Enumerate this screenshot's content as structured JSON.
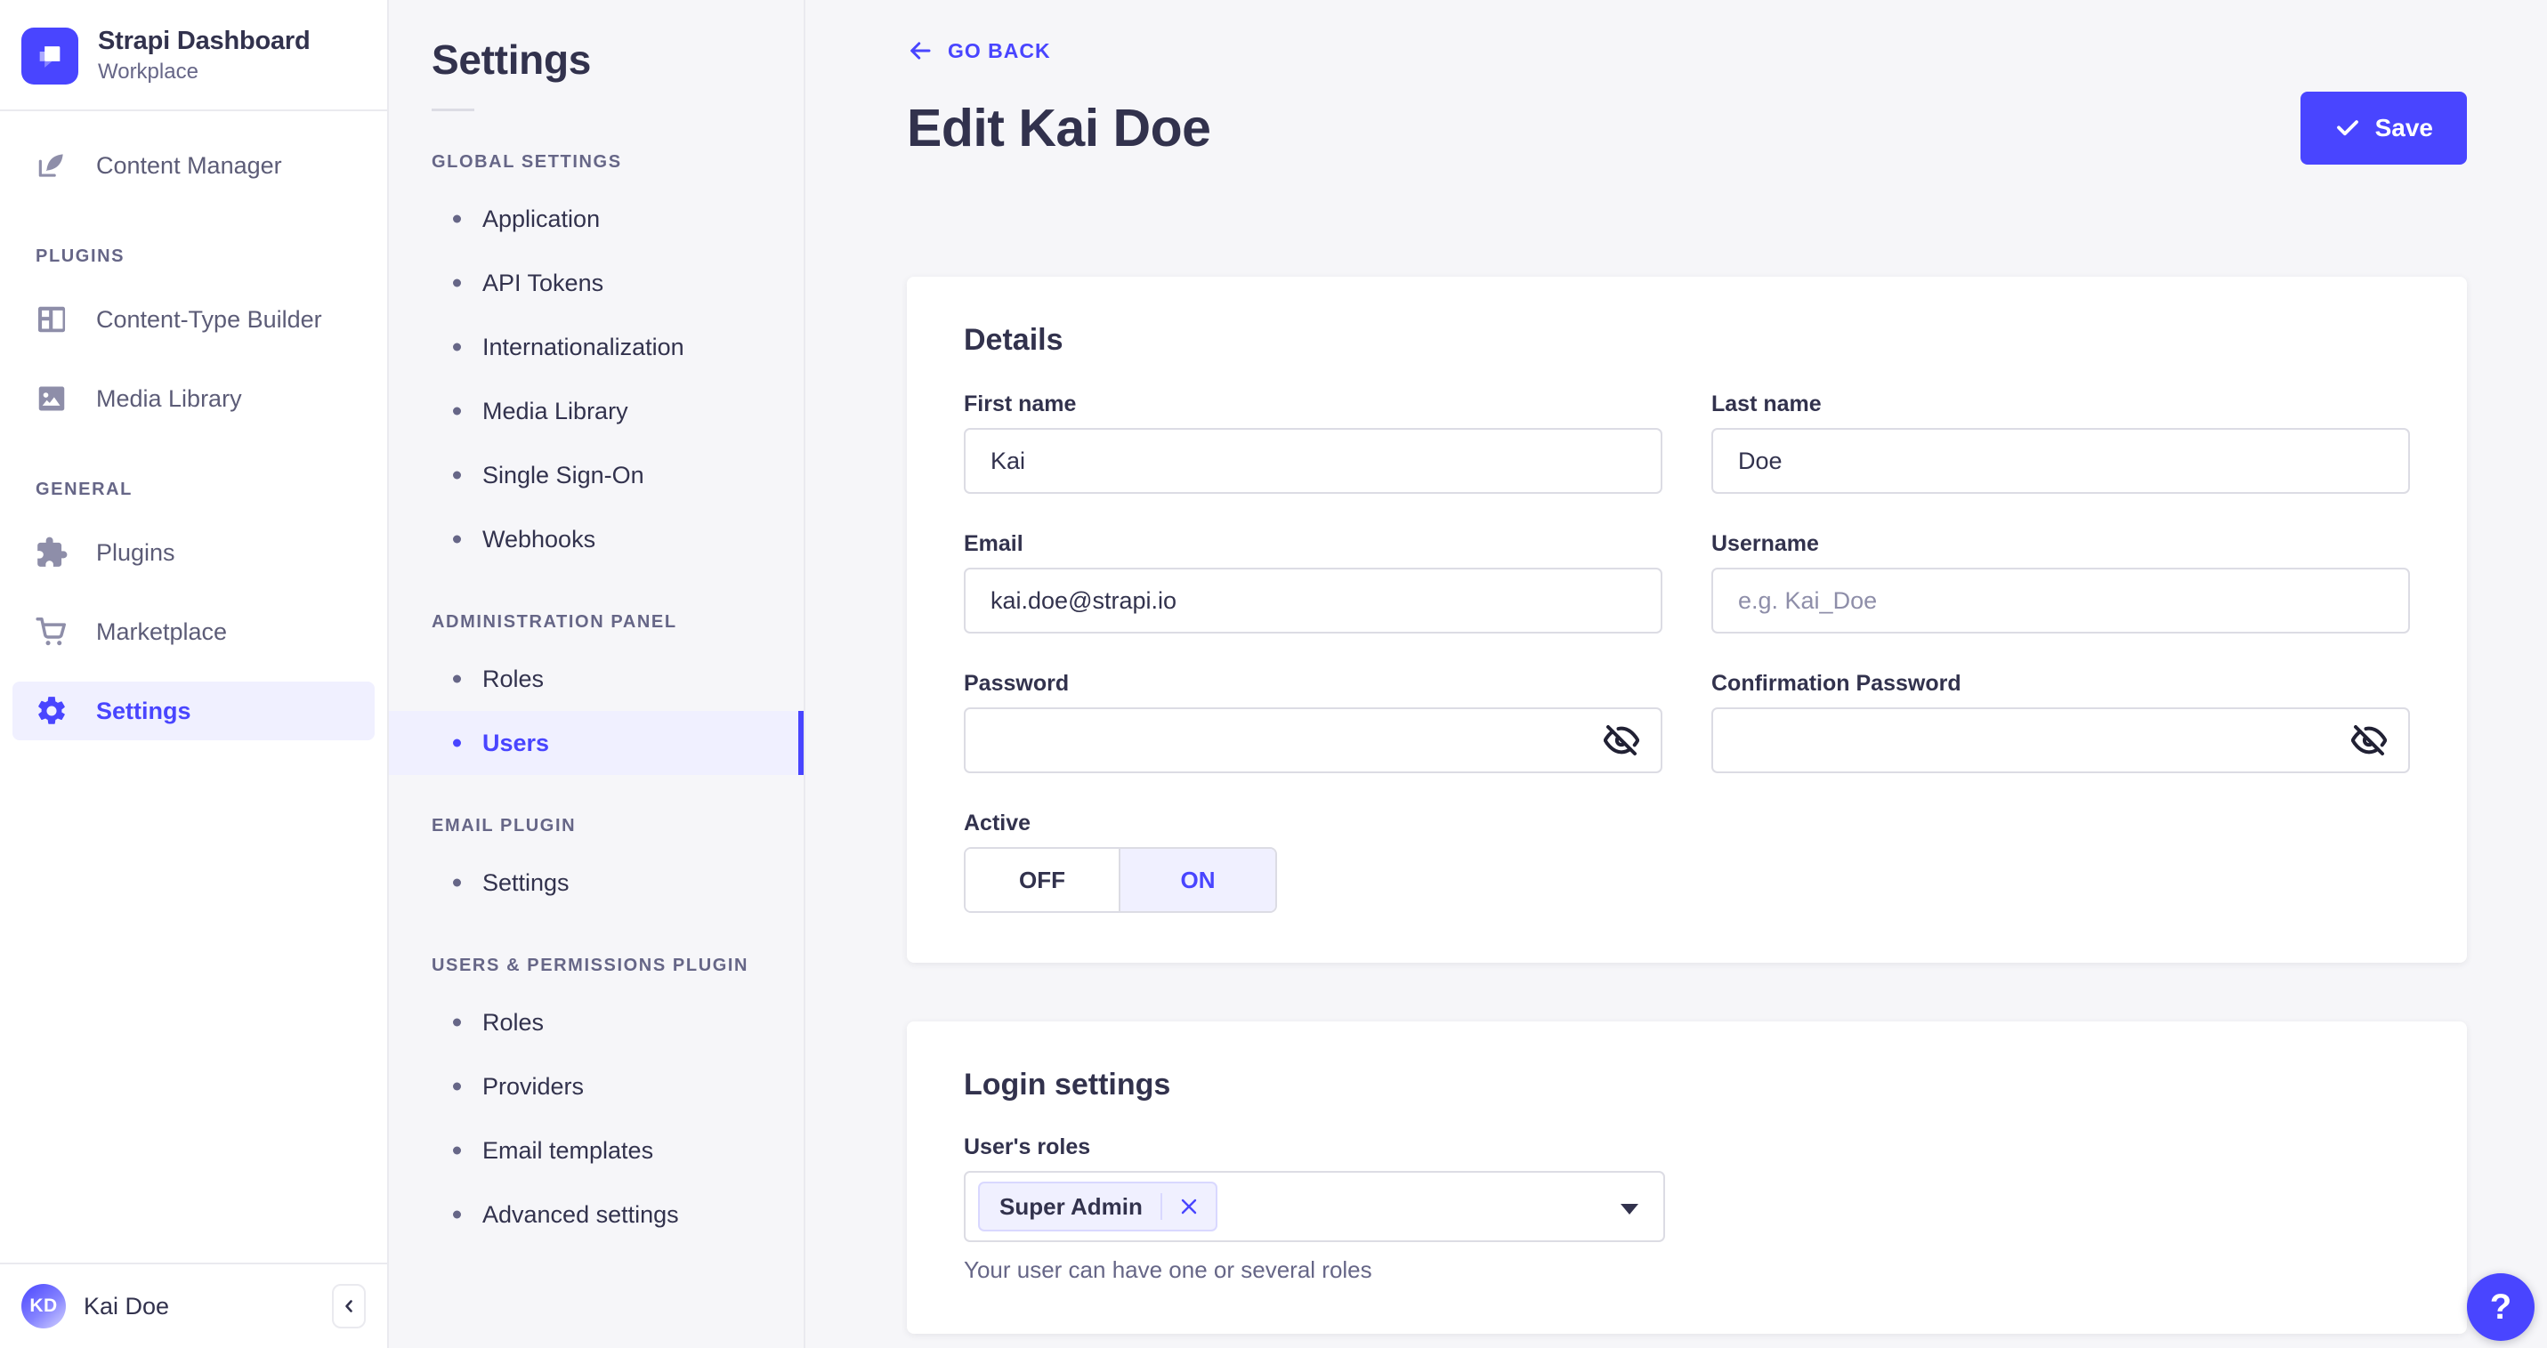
{
  "colors": {
    "primary": "#4945ff",
    "primary_light_bg": "#f0f0ff",
    "text_dark": "#32324d",
    "text_muted": "#666687",
    "input_border": "#dcdce4",
    "divider": "#eaeaef",
    "page_bg": "#f6f6f9",
    "placeholder": "#8e8ea9"
  },
  "brand": {
    "title": "Strapi Dashboard",
    "subtitle": "Workplace"
  },
  "sidebar": {
    "content_manager": {
      "label": "Content Manager",
      "icon": "feather-pen-icon"
    },
    "sections": [
      {
        "header": "Plugins",
        "items": [
          {
            "label": "Content-Type Builder",
            "icon": "layout-icon"
          },
          {
            "label": "Media Library",
            "icon": "image-icon"
          }
        ]
      },
      {
        "header": "General",
        "items": [
          {
            "label": "Plugins",
            "icon": "puzzle-icon"
          },
          {
            "label": "Marketplace",
            "icon": "cart-icon"
          },
          {
            "label": "Settings",
            "icon": "gear-icon",
            "active": true
          }
        ]
      }
    ],
    "user": {
      "initials": "KD",
      "name": "Kai Doe"
    },
    "collapse_glyph": "‹"
  },
  "subnav": {
    "title": "Settings",
    "sections": [
      {
        "header": "Global Settings",
        "items": [
          "Application",
          "API Tokens",
          "Internationalization",
          "Media Library",
          "Single Sign-On",
          "Webhooks"
        ]
      },
      {
        "header": "Administration Panel",
        "items": [
          "Roles",
          "Users"
        ],
        "active_item": "Users"
      },
      {
        "header": "Email Plugin",
        "items": [
          "Settings"
        ]
      },
      {
        "header": "Users & Permissions plugin",
        "items": [
          "Roles",
          "Providers",
          "Email templates",
          "Advanced settings"
        ]
      }
    ]
  },
  "header": {
    "back_label": "Go back",
    "title": "Edit Kai Doe",
    "save_label": "Save"
  },
  "details": {
    "title": "Details",
    "fields": {
      "first_name": {
        "label": "First name",
        "value": "Kai"
      },
      "last_name": {
        "label": "Last name",
        "value": "Doe"
      },
      "email": {
        "label": "Email",
        "value": "kai.doe@strapi.io"
      },
      "username": {
        "label": "Username",
        "value": "",
        "placeholder": "e.g. Kai_Doe"
      },
      "password": {
        "label": "Password",
        "value": ""
      },
      "confirmation_password": {
        "label": "Confirmation Password",
        "value": ""
      }
    },
    "active_toggle": {
      "label": "Active",
      "off": "OFF",
      "on": "ON",
      "value": "ON"
    }
  },
  "login_settings": {
    "title": "Login settings",
    "roles_label": "User's roles",
    "selected_roles": [
      {
        "name": "Super Admin"
      }
    ],
    "helper": "Your user can have one or several roles"
  },
  "help": {
    "glyph": "?"
  }
}
